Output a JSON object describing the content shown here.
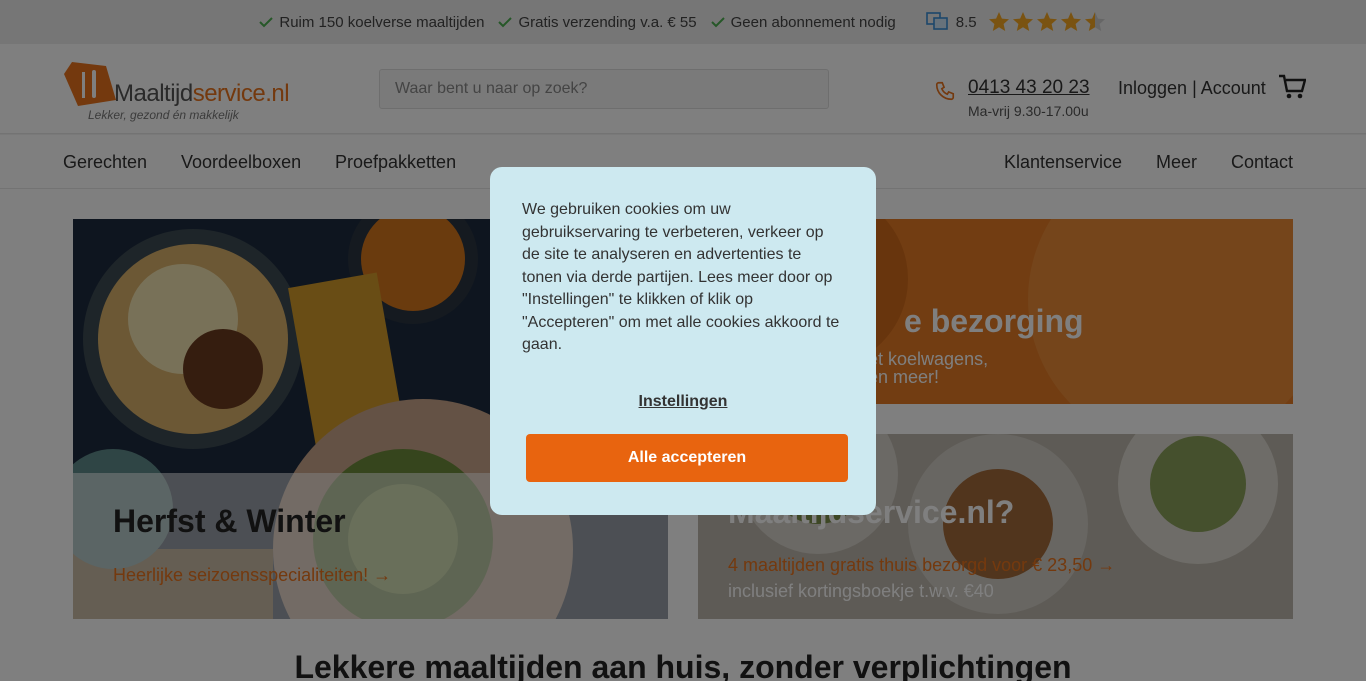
{
  "topbar": {
    "usps": [
      "Ruim 150 koelverse maaltijden",
      "Gratis verzending v.a. € 55",
      "Geen abonnement nodig"
    ],
    "rating_score": "8.5",
    "rating_stars": 4.5,
    "check_color": "#4caf50",
    "star_color": "#f5a623"
  },
  "header": {
    "logo_text_a": "Maaltijd",
    "logo_text_b": "service.nl",
    "logo_tagline": "Lekker, gezond én makkelijk",
    "search_placeholder": "Waar bent u naar op zoek?",
    "phone": "0413 43 20 23",
    "hours": "Ma-vrij 9.30-17.00u",
    "account": "Inloggen | Account",
    "accent_color": "#e8731c"
  },
  "nav": {
    "left": [
      "Gerechten",
      "Voordeelboxen",
      "Proefpakketten"
    ],
    "right": [
      "Klantenservice",
      "Meer",
      "Contact"
    ]
  },
  "cards": {
    "winter": {
      "title": "Herfst & Winter",
      "link": "Heerlijke seizoensspecialiteiten! →"
    },
    "delivery": {
      "title_partial": "e bezorging",
      "line1_partial": "et koelwagens,",
      "line2_partial": "en meer!"
    },
    "why": {
      "title_partial": "Maaltijdservice.nl?",
      "link": "4 maaltijden gratis thuis bezorgd voor € 23,50 →",
      "sub": "inclusief kortingsboekje t.w.v. €40"
    }
  },
  "headline": "Lekkere maaltijden aan huis, zonder verplichtingen",
  "cookie_modal": {
    "text": "We gebruiken cookies om uw gebruikservaring te verbeteren, verkeer op de site te analyseren en advertenties te tonen via derde partijen. Lees meer door op \"Instellingen\" te klikken of klik op \"Accepteren\" om met alle cookies akkoord te gaan.",
    "settings_label": "Instellingen",
    "accept_label": "Alle accepteren"
  }
}
